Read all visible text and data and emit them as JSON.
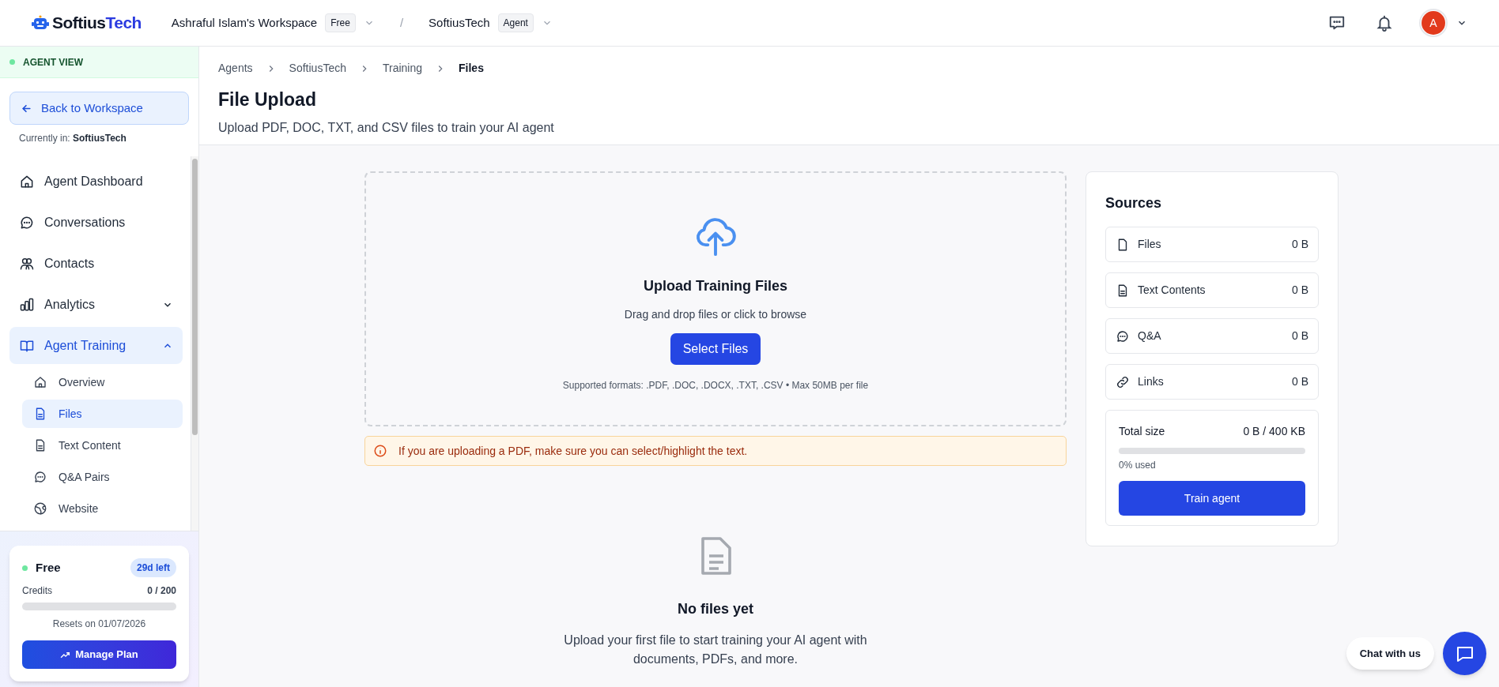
{
  "header": {
    "logo": {
      "part_1": "Softius",
      "part_2": "Tech"
    },
    "workspace": {
      "name": "Ashraful Islam's Workspace",
      "badge": "Free"
    },
    "separator": "/",
    "agent": {
      "name": "SoftiusTech",
      "badge": "Agent"
    },
    "avatar": "A"
  },
  "sidebar": {
    "mode_label": "AGENT VIEW",
    "back_button": "Back to Workspace",
    "current_label": "Currently in:",
    "current_value": "SoftiusTech",
    "nav_items": [
      {
        "label": "Agent Dashboard",
        "selected": false
      },
      {
        "label": "Conversations",
        "selected": false
      },
      {
        "label": "Contacts",
        "selected": false
      },
      {
        "label": "Analytics",
        "selected": false,
        "expanded": false
      },
      {
        "label": "Agent Training",
        "selected": true,
        "expanded": true,
        "children": [
          {
            "label": "Overview",
            "selected": false
          },
          {
            "label": "Files",
            "selected": true
          },
          {
            "label": "Text Content",
            "selected": false
          },
          {
            "label": "Q&A Pairs",
            "selected": false
          },
          {
            "label": "Website",
            "selected": false
          }
        ]
      }
    ],
    "plan": {
      "name": "Free",
      "badge": "29d left",
      "credits_label": "Credits",
      "credits_value": "0 / 200",
      "level": 0,
      "reset_text": "Resets on 01/07/2026",
      "button": "Manage Plan"
    }
  },
  "main": {
    "breadcrumbs": [
      "Agents",
      "SoftiusTech",
      "Training",
      "Files"
    ],
    "title": "File Upload",
    "subtitle": "Upload PDF, DOC, TXT, and CSV files to train your AI agent",
    "upload": {
      "title": "Upload Training Files",
      "hint": "Drag and drop files or click to browse",
      "button": "Select Files",
      "formats": "Supported formats: .PDF, .DOC, .DOCX, .TXT, .CSV • Max 50MB per file"
    },
    "notice": "If you are uploading a PDF, make sure you can select/highlight the text.",
    "empty_state": {
      "title": "No files yet",
      "text": "Upload your first file to start training your AI agent with documents, PDFs, and more."
    }
  },
  "sources": {
    "title": "Sources",
    "items": [
      {
        "label": "Files",
        "size": "0 B"
      },
      {
        "label": "Text Contents",
        "size": "0 B"
      },
      {
        "label": "Q&A",
        "size": "0 B"
      },
      {
        "label": "Links",
        "size": "0 B"
      }
    ],
    "total_label": "Total size",
    "total_value": "0 B / 400 KB",
    "level": 0,
    "used_text": "0% used",
    "button": "Train agent"
  },
  "chat": {
    "label": "Chat with us"
  }
}
